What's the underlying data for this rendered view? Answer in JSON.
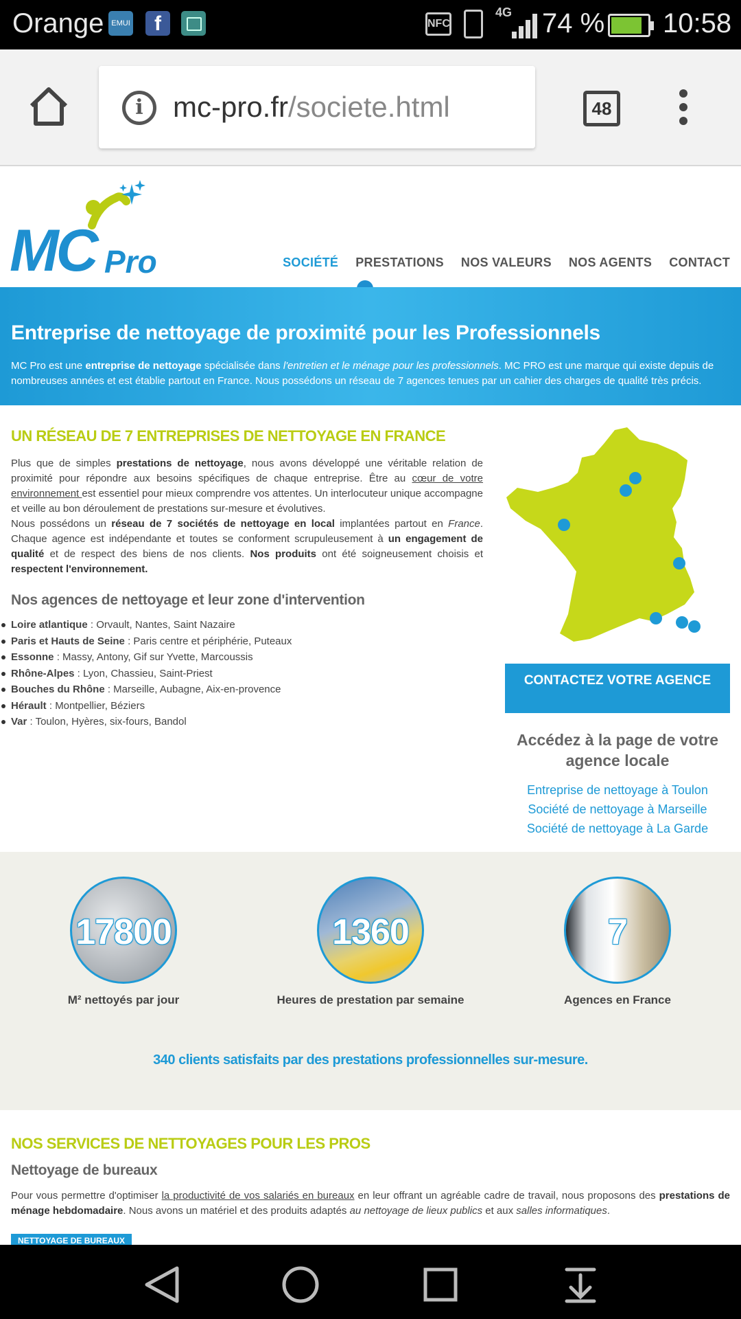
{
  "status_bar": {
    "carrier": "Orange",
    "emui_label": "EMUI",
    "fb_label": "f",
    "nfc_label": "NFC",
    "network": "4G",
    "battery": "74 %",
    "time": "10:58"
  },
  "browser": {
    "url_domain": "mc-pro.fr",
    "url_path": "/societe.html",
    "tab_count": "48"
  },
  "site": {
    "logo_mc": "MC",
    "logo_pro": "Pro",
    "nav": [
      "SOCIÉTÉ",
      "PRESTATIONS",
      "NOS VALEURS",
      "NOS AGENTS",
      "CONTACT"
    ],
    "active_nav": "SOCIÉTÉ"
  },
  "hero": {
    "title": "Entreprise de nettoyage de proximité pour les Professionnels",
    "text_parts": {
      "a": "MC Pro est une ",
      "b": "entreprise de nettoyage",
      "c": " spécialisée dans ",
      "d": "l'entretien et le ménage pour les professionnels",
      "e": ". MC PRO est une marque qui existe depuis de nombreuses années et est établie partout en France. Nous possédons un réseau de 7 agences tenues par un cahier des charges de qualité très précis."
    }
  },
  "network_section": {
    "title": "UN RÉSEAU DE 7 ENTREPRISES DE NETTOYAGE EN FRANCE",
    "p1": {
      "a": "Plus que de simples ",
      "b": "prestations de nettoyage",
      "c": ", nous avons développé une véritable relation de proximité pour répondre aux besoins spécifiques de chaque entreprise. Être au ",
      "d": "cœur de votre environnement ",
      "e": "est essentiel pour mieux comprendre vos attentes. Un interlocuteur unique accompagne et veille au bon déroulement de prestations sur-mesure et évolutives."
    },
    "p2": {
      "a": "Nous possédons un ",
      "b": "réseau de 7 sociétés de nettoyage en local",
      "c": " implantées partout en ",
      "d": "France",
      "e": ". Chaque agence est indépendante et toutes se conforment scrupuleusement à ",
      "f": "un engagement de qualité",
      "g": " et de respect des biens de nos clients. ",
      "h": "Nos produits",
      "i": " ont été soigneusement choisis et ",
      "j": "respectent l'environnement."
    },
    "agencies_title": "Nos agences de nettoyage et leur zone d'intervention",
    "agencies": [
      {
        "region": "Loire atlantique",
        "cities": " : Orvault, Nantes, Saint Nazaire"
      },
      {
        "region": "Paris et Hauts de Seine",
        "cities": " : Paris centre et périphérie, Puteaux"
      },
      {
        "region": "Essonne",
        "cities": " : Massy, Antony, Gif sur Yvette, Marcoussis"
      },
      {
        "region": "Rhône-Alpes",
        "cities": " : Lyon, Chassieu, Saint-Priest"
      },
      {
        "region": "Bouches du Rhône",
        "cities": " : Marseille, Aubagne, Aix-en-provence"
      },
      {
        "region": "Hérault",
        "cities": " : Montpellier, Béziers"
      },
      {
        "region": "Var",
        "cities": " : Toulon, Hyères, six-fours, Bandol"
      }
    ]
  },
  "sidebar": {
    "cta": "CONTACTEZ VOTRE AGENCE",
    "access_title": "Accédez à la page de votre agence locale",
    "links": [
      "Entreprise de nettoyage à Toulon",
      "Société de nettoyage à Marseille",
      "Société de nettoyage à La Garde"
    ]
  },
  "stats": {
    "items": [
      {
        "value": "17800",
        "label": "M² nettoyés par jour"
      },
      {
        "value": "1360",
        "label": "Heures de prestation par semaine"
      },
      {
        "value": "7",
        "label": "Agences en France"
      }
    ],
    "tagline": "340 clients satisfaits par des prestations professionnelles sur-mesure."
  },
  "services": {
    "title": "NOS SERVICES DE NETTOYAGES POUR LES PROS",
    "subtitle": "Nettoyage de bureaux",
    "p": {
      "a": "Pour vous permettre d'optimiser ",
      "b": "la productivité de vos salariés en bureaux",
      "c": " en leur offrant un agréable cadre de travail, nous proposons des ",
      "d": "prestations de ménage hebdomadaire",
      "e": ". Nous avons un matériel et des produits adaptés ",
      "f": "au nettoyage de lieux publics",
      "g": " et aux ",
      "h": "salles informatiques",
      "i": "."
    },
    "button": "NETTOYAGE DE BUREAUX"
  },
  "colors": {
    "brand_blue": "#1e9ad6",
    "brand_lime": "#b9cc13"
  }
}
